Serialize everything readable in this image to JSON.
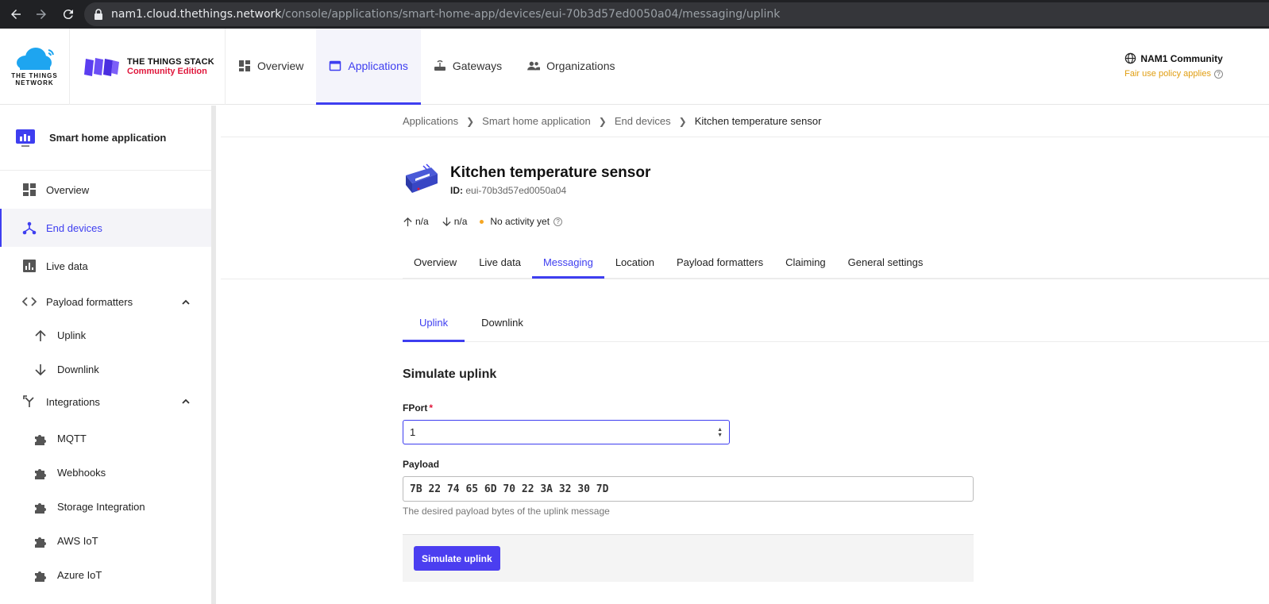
{
  "browser": {
    "url_host": "nam1.cloud.thethings.network",
    "url_path": "/console/applications/smart-home-app/devices/eui-70b3d57ed0050a04/messaging/uplink"
  },
  "header": {
    "ttn_logo_text": "THE THINGS NETWORK",
    "tts_title": "THE THINGS STACK",
    "tts_edition": "Community Edition",
    "nav": [
      {
        "label": "Overview",
        "icon": "dashboard-icon"
      },
      {
        "label": "Applications",
        "icon": "window-icon"
      },
      {
        "label": "Gateways",
        "icon": "router-icon"
      },
      {
        "label": "Organizations",
        "icon": "people-icon"
      }
    ],
    "cluster_name": "NAM1 Community",
    "fair_use": "Fair use policy applies"
  },
  "sidebar": {
    "app_name": "Smart home application",
    "items": [
      {
        "label": "Overview"
      },
      {
        "label": "End devices"
      },
      {
        "label": "Live data"
      },
      {
        "label": "Payload formatters"
      },
      {
        "label": "Uplink"
      },
      {
        "label": "Downlink"
      },
      {
        "label": "Integrations"
      },
      {
        "label": "MQTT"
      },
      {
        "label": "Webhooks"
      },
      {
        "label": "Storage Integration"
      },
      {
        "label": "AWS IoT"
      },
      {
        "label": "Azure IoT"
      }
    ]
  },
  "breadcrumb": [
    "Applications",
    "Smart home application",
    "End devices",
    "Kitchen temperature sensor"
  ],
  "device": {
    "title": "Kitchen temperature sensor",
    "id_label": "ID:",
    "id": "eui-70b3d57ed0050a04",
    "uplink_count": "n/a",
    "downlink_count": "n/a",
    "activity": "No activity yet"
  },
  "tabs": [
    "Overview",
    "Live data",
    "Messaging",
    "Location",
    "Payload formatters",
    "Claiming",
    "General settings"
  ],
  "subtabs": [
    "Uplink",
    "Downlink"
  ],
  "form": {
    "title": "Simulate uplink",
    "fport_label": "FPort",
    "fport_value": "1",
    "payload_label": "Payload",
    "payload_value": "7B 22 74 65 6D 70 22 3A 32 30 7D",
    "payload_hint": "The desired payload bytes of the uplink message",
    "submit_label": "Simulate uplink"
  },
  "colors": {
    "accent": "#3e3ef0",
    "brand_red": "#e0163b",
    "warning": "#e09d10"
  }
}
